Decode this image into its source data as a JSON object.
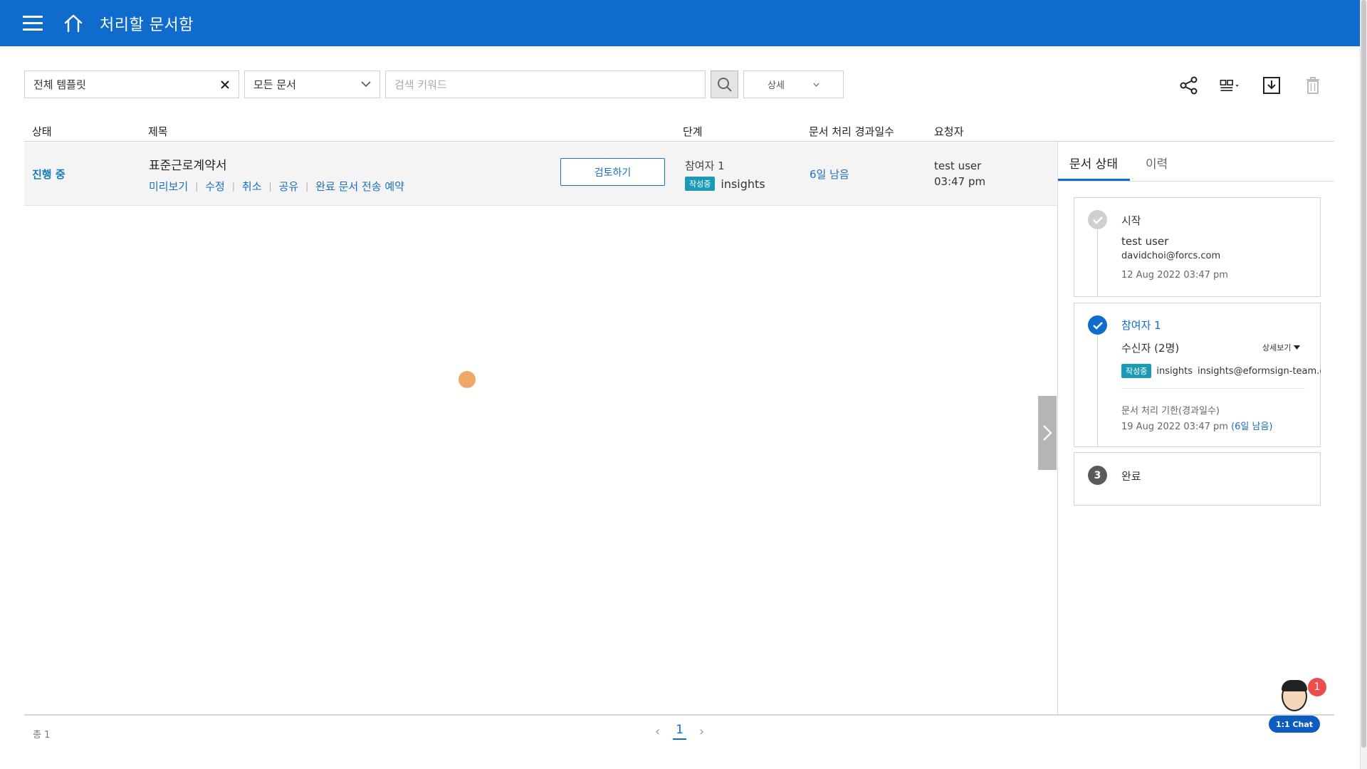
{
  "header": {
    "title": "처리할 문서함"
  },
  "filters": {
    "template": "전체 템플릿",
    "doc_type": "모든 문서",
    "search_placeholder": "검색 키워드",
    "detail": "상세"
  },
  "table": {
    "headers": {
      "status": "상태",
      "title": "제목",
      "stage": "단계",
      "days": "문서 처리 경과일수",
      "requester": "요청자"
    },
    "rows": [
      {
        "status": "진행 중",
        "title": "표준근로계약서",
        "actions": [
          "미리보기",
          "수정",
          "취소",
          "공유",
          "완료 문서 전송 예약"
        ],
        "review_button": "검토하기",
        "stage": "참여자 1",
        "stage_badge": "작성중",
        "stage_user": "insights",
        "days": "6일 남음",
        "requester_name": "test user",
        "requester_time": "03:47 pm"
      }
    ]
  },
  "panel": {
    "tabs": [
      "문서 상태",
      "이력"
    ],
    "start": {
      "label": "시작",
      "name": "test user",
      "email": "davidchoi@forcs.com",
      "time": "12 Aug 2022 03:47 pm"
    },
    "participant": {
      "label": "참여자 1",
      "recipients": "수신자 (2명)",
      "details_toggle": "상세보기",
      "badge": "작성중",
      "user": "insights",
      "email": "insights@eformsign-team.com",
      "deadline_label": "문서 처리 기한(경과일수)",
      "deadline": "19 Aug 2022 03:47 pm",
      "deadline_remaining": "(6일 남음)"
    },
    "complete": {
      "number": "3",
      "label": "완료"
    }
  },
  "footer": {
    "total": "총 1",
    "page": "1"
  },
  "chat": {
    "label": "1:1 Chat",
    "count": "1"
  },
  "colors": {
    "primary": "#0f6ccd",
    "badge": "#1b9ab5",
    "link": "#1a6fc2",
    "status": "#137cb8"
  }
}
